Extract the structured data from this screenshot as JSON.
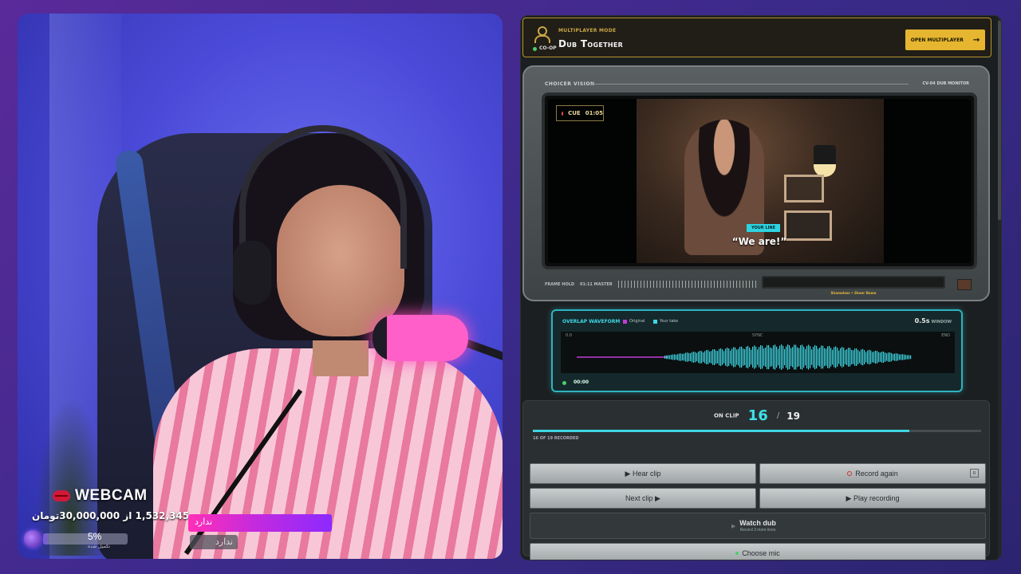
{
  "webcam": {
    "label": "WEBCAM",
    "donation_line": "1,532,345 از 30,000,000تومان",
    "progress": {
      "percent_label": "5%",
      "fraction": 0.05,
      "sub_label": "تکمیل شده"
    },
    "tag_primary": "ندارد",
    "tag_secondary": "ندارد"
  },
  "multiplayer": {
    "mode_label": "MULTIPLAYER MODE",
    "title": "Dub Together",
    "coop_label": "CO-OP",
    "open_button": "OPEN MULTIPLAYER"
  },
  "monitor": {
    "brand": "CHOICER VISION",
    "model": "CV-04 DUB MONITOR",
    "cue_label": "CUE",
    "cue_time": "01:05",
    "your_line_tag": "YOUR LINE",
    "subtitle": "“We are!”",
    "frame_hold": "FRAME HOLD",
    "master_time": "01:11 MASTER",
    "credit": "Shameless • Sheer Name"
  },
  "waveform": {
    "title": "OVERLAP WAVEFORM",
    "legend": [
      {
        "label": "Original",
        "color": "#c23ad6"
      },
      {
        "label": "Your take",
        "color": "#3fd6e3"
      }
    ],
    "window_value": "0.5s",
    "window_label": "WINDOW",
    "marker_start": "0.0",
    "marker_sync": "SYNC",
    "marker_end": "END",
    "time": "00:00"
  },
  "clip": {
    "on_clip_label": "ON CLIP",
    "current": "16",
    "separator": "/",
    "total": "19",
    "progress_fraction": 0.84,
    "recorded_note": "16 OF 19 RECORDED"
  },
  "actions": {
    "hear_clip": "▶ Hear clip",
    "record_again": "Record again",
    "record_key": "R",
    "next_clip": "Next clip ▶",
    "play_recording": "▶ Play recording",
    "watch_dub": "Watch dub",
    "watch_dub_sub": "Record 3 more lines",
    "choose_mic": "Choose mic"
  }
}
